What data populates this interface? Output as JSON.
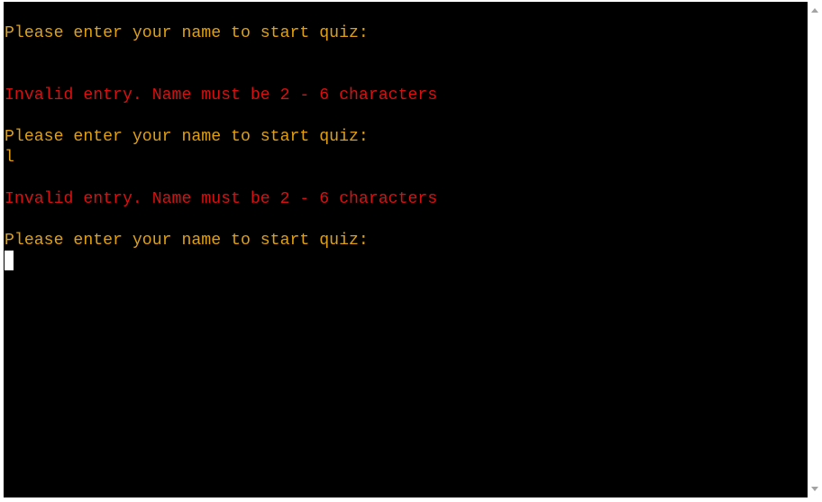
{
  "terminal": {
    "lines": [
      {
        "text": "Please enter your name to start quiz:",
        "kind": "prompt"
      },
      {
        "text": "",
        "kind": "input"
      },
      {
        "text": "Invalid entry. Name must be 2 - 6 characters",
        "kind": "error"
      },
      {
        "text": "Please enter your name to start quiz:",
        "kind": "prompt"
      },
      {
        "text": "l",
        "kind": "input"
      },
      {
        "text": "Invalid entry. Name must be 2 - 6 characters",
        "kind": "error"
      },
      {
        "text": "Please enter your name to start quiz:",
        "kind": "prompt"
      }
    ]
  },
  "colors": {
    "background": "#000000",
    "prompt": "#e0a010",
    "error": "#d81010",
    "cursor": "#ffffff"
  },
  "icons": {
    "scroll_up": "triangle-up",
    "scroll_down": "triangle-down"
  }
}
